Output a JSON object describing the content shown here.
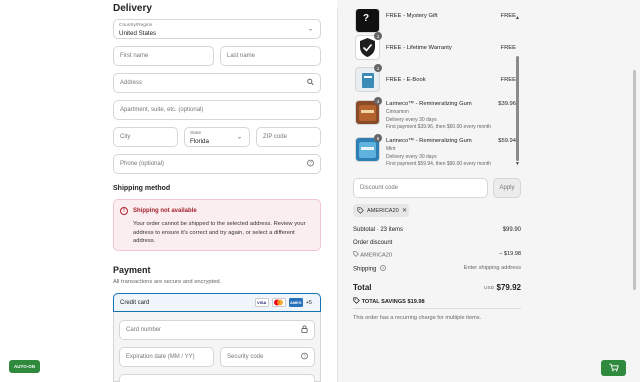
{
  "delivery": {
    "title": "Delivery",
    "country_label": "Country/Region",
    "country_value": "United States",
    "first_name_ph": "First name",
    "last_name_ph": "Last name",
    "address_ph": "Address",
    "apartment_ph": "Apartment, suite, etc. (optional)",
    "city_ph": "City",
    "state_label": "State",
    "state_value": "Florida",
    "zip_ph": "ZIP code",
    "phone_ph": "Phone (optional)"
  },
  "shipping": {
    "title": "Shipping method",
    "alert_title": "Shipping not available",
    "alert_message": "Your order cannot be shipped to the selected address. Review your address to ensure it's correct and try again, or select a different address."
  },
  "payment": {
    "title": "Payment",
    "subtitle": "All transactions are secure and encrypted.",
    "credit_card_label": "Credit card",
    "cards": [
      "VISA",
      "MC",
      "AMEX"
    ],
    "more_cards": "+5",
    "card_number_ph": "Card number",
    "expiry_ph": "Expiration date (MM / YY)",
    "security_ph": "Security code"
  },
  "auto_badge": "AUTO-ON",
  "items": [
    {
      "name": "FREE - Mystery Gift",
      "price": "FREE",
      "qty": "1"
    },
    {
      "name": "FREE - Lifetime Warranty",
      "price": "FREE",
      "qty": "1"
    },
    {
      "name": "FREE - E-Book",
      "price": "FREE",
      "qty": "1"
    },
    {
      "name": "Larineco™ - Remineralizing Gum",
      "variant": "Cinnamon",
      "price": "$39.96",
      "qty": "4",
      "line1": "Delivery every 30 days",
      "line2": "First payment $39.96, then $60.00 every month"
    },
    {
      "name": "Larineco™ - Remineralizing Gum",
      "variant": "Mint",
      "price": "$59.94",
      "qty": "6",
      "line1": "Delivery every 30 days",
      "line2": "First payment $59.94, then $90.00 every month"
    }
  ],
  "discount": {
    "placeholder": "Discount code",
    "apply": "Apply",
    "code": "AMERICA20"
  },
  "summary": {
    "subtotal_label": "Subtotal · 23 items",
    "subtotal_value": "$99.90",
    "order_discount_label": "Order discount",
    "order_discount_code": "AMERICA20",
    "order_discount_value": "− $19.98",
    "shipping_label": "Shipping",
    "shipping_value": "Enter shipping address",
    "total_label": "Total",
    "currency": "USD",
    "total_value": "$79.92",
    "savings_label": "TOTAL SAVINGS",
    "savings_value": "$19.98",
    "recurring_note": "This order has a recurring charge for multiple items."
  },
  "colors": {
    "accent": "#1773b0",
    "alert_bg": "#fbeef0",
    "alert_text": "#a3222d",
    "green": "#2f8a3e"
  }
}
